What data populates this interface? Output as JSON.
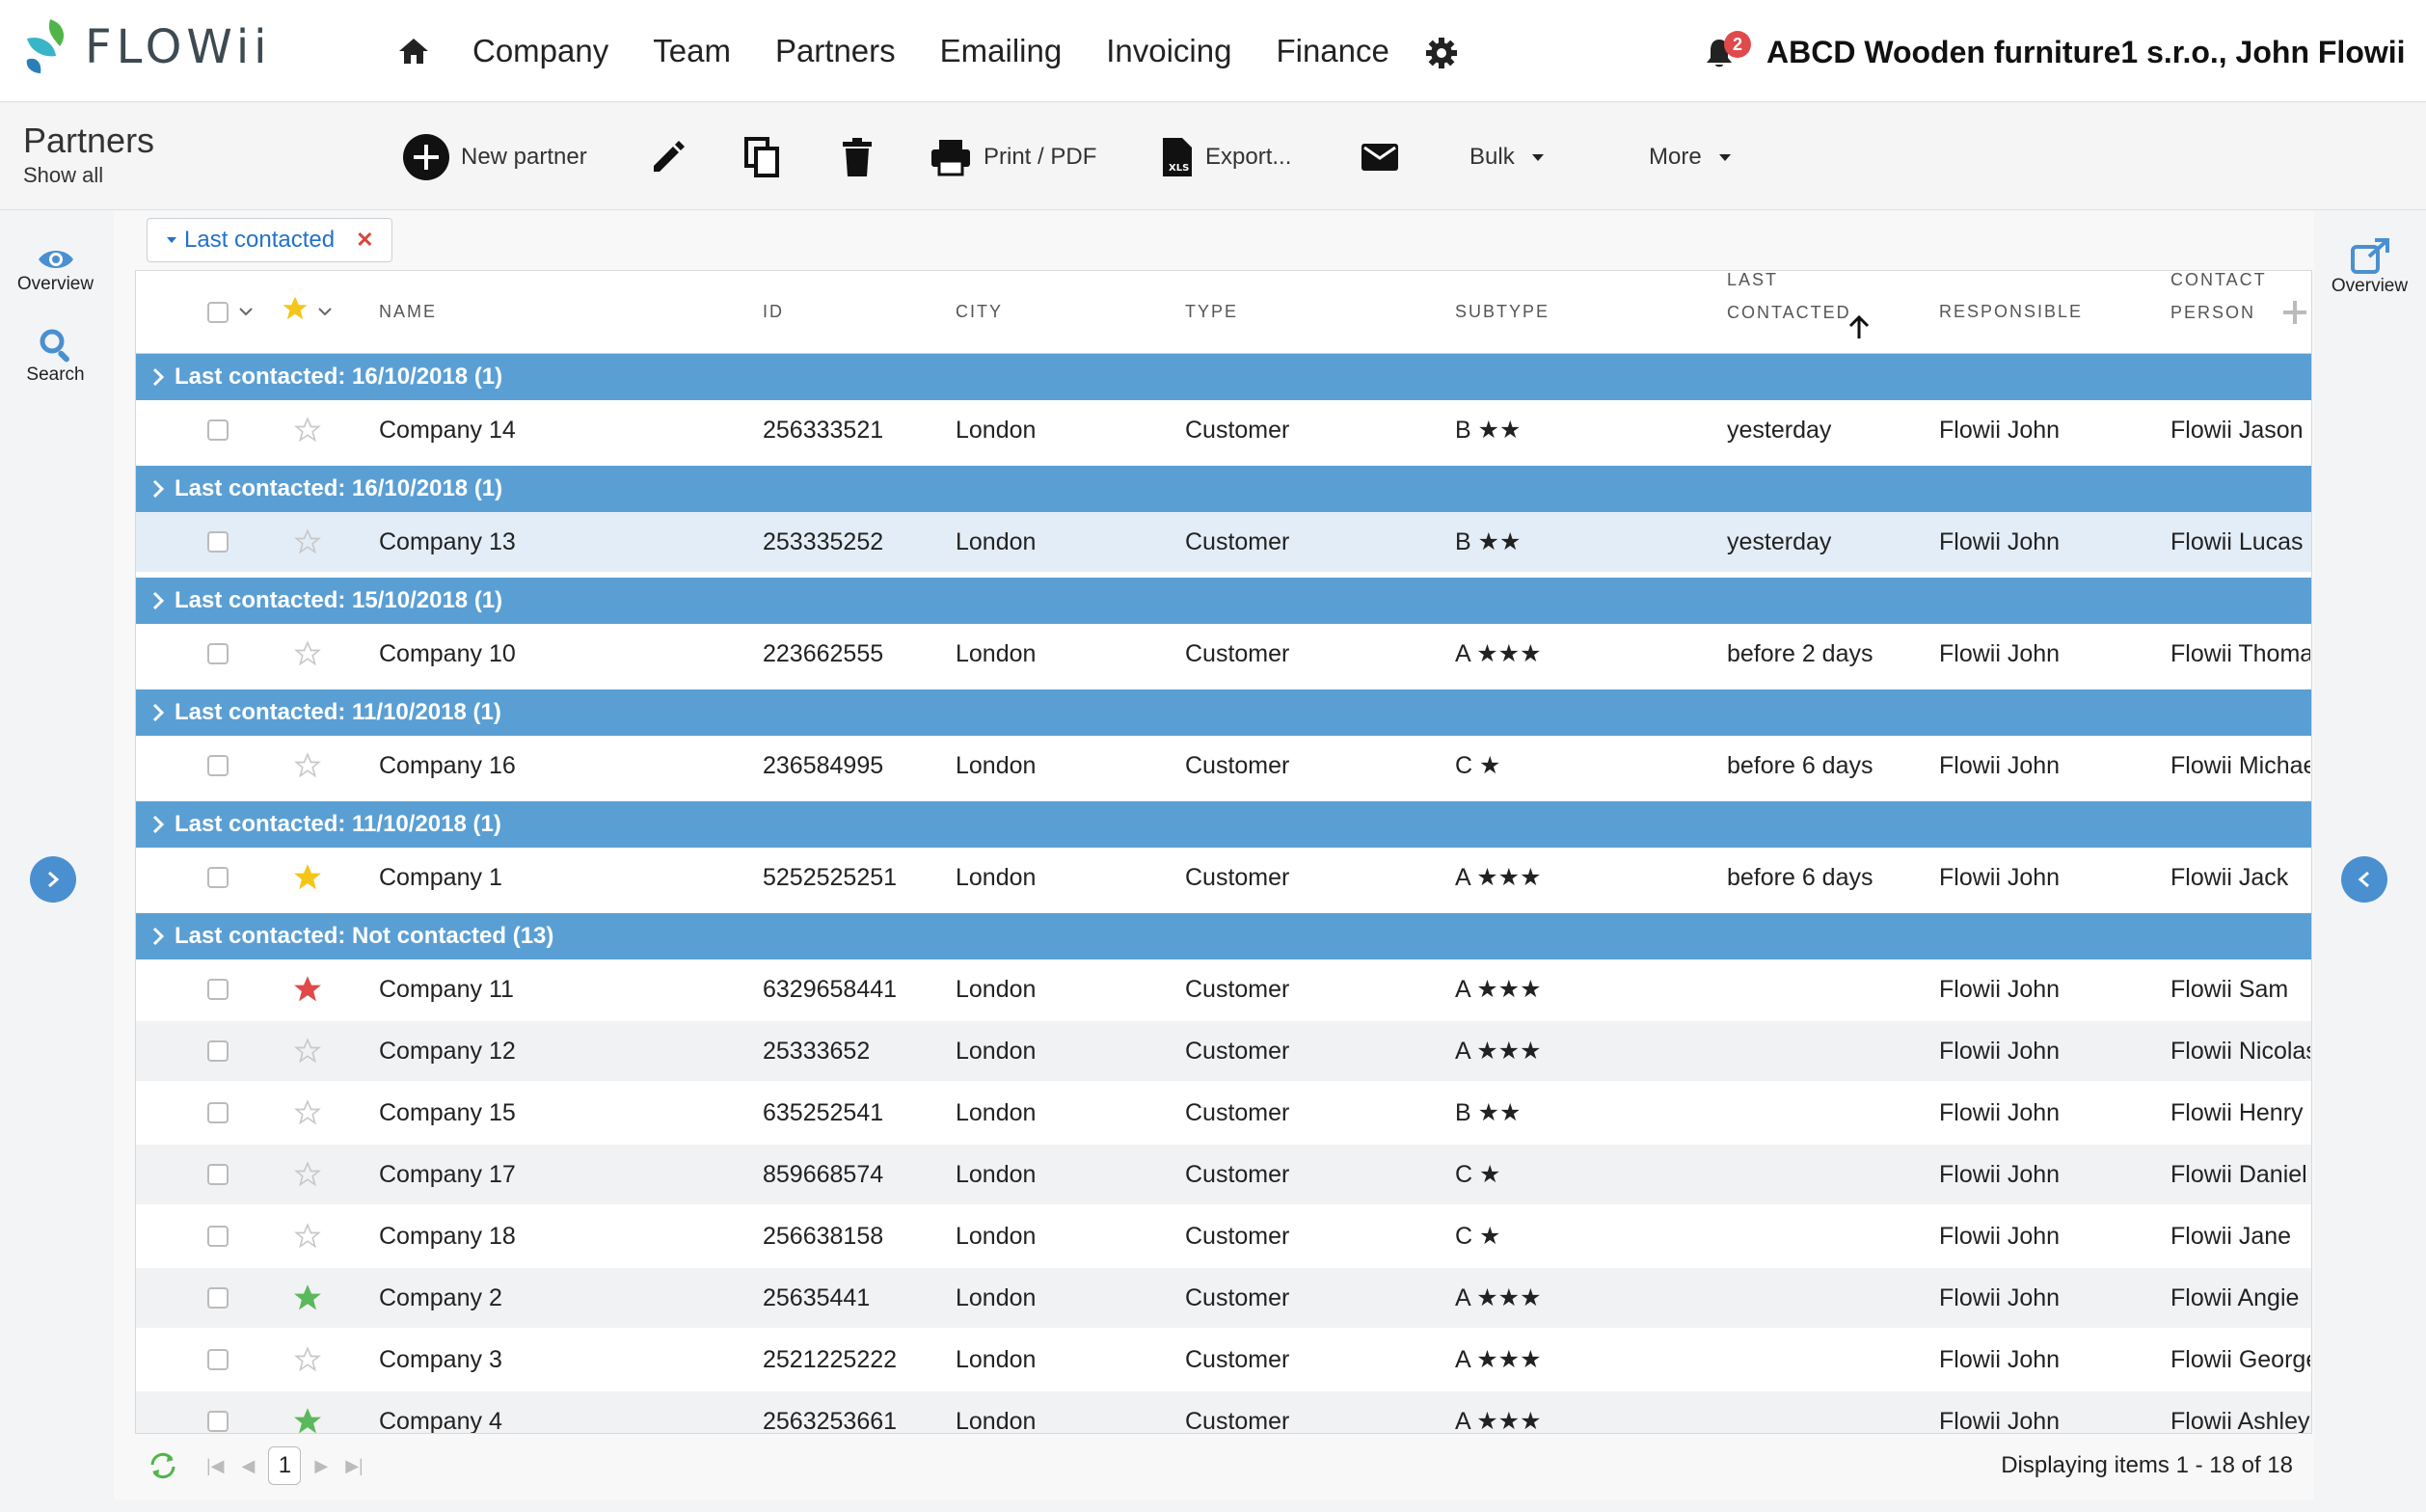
{
  "app": {
    "logo_text": "FLOWii",
    "company_user": "ABCD Wooden furniture1 s.r.o., John Flowii",
    "notification_count": "2"
  },
  "nav": [
    "Company",
    "Team",
    "Partners",
    "Emailing",
    "Invoicing",
    "Finance"
  ],
  "page": {
    "title": "Partners",
    "subtitle": "Show all"
  },
  "toolbar": {
    "new_partner": "New partner",
    "print": "Print / PDF",
    "export": "Export...",
    "bulk": "Bulk",
    "more": "More"
  },
  "side": {
    "overview": "Overview",
    "search": "Search",
    "right_overview": "Overview"
  },
  "filter": {
    "label": "Last contacted"
  },
  "columns": {
    "name": "NAME",
    "id": "ID",
    "city": "CITY",
    "type": "TYPE",
    "subtype": "SUBTYPE",
    "last1": "LAST",
    "last2": "CONTACTED",
    "responsible": "RESPONSIBLE",
    "contact1": "CONTACT",
    "contact2": "PERSON"
  },
  "colors": {
    "group": "#5a9fd4",
    "accent": "#4a90d0",
    "star_yellow": "#f5c518",
    "star_red": "#e04a4a",
    "star_green": "#5cb85c"
  },
  "groups": [
    {
      "label": "Last contacted: 16/10/2018 (1)"
    },
    {
      "label": "Last contacted: 16/10/2018 (1)"
    },
    {
      "label": "Last contacted: 15/10/2018 (1)"
    },
    {
      "label": "Last contacted: 11/10/2018 (1)"
    },
    {
      "label": "Last contacted: 11/10/2018 (1)"
    },
    {
      "label": "Last contacted: Not contacted (13)"
    }
  ],
  "rows": [
    {
      "name": "Company 14",
      "id": "256333521",
      "city": "London",
      "type": "Customer",
      "subtype": "B ★★",
      "last": "yesterday",
      "responsible": "Flowii John",
      "contact": "Flowii Jason",
      "star": "empty"
    },
    {
      "name": "Company 13",
      "id": "253335252",
      "city": "London",
      "type": "Customer",
      "subtype": "B ★★",
      "last": "yesterday",
      "responsible": "Flowii John",
      "contact": "Flowii Lucas",
      "star": "empty"
    },
    {
      "name": "Company 10",
      "id": "223662555",
      "city": "London",
      "type": "Customer",
      "subtype": "A ★★★",
      "last": "before 2 days",
      "responsible": "Flowii John",
      "contact": "Flowii Thomas",
      "star": "empty"
    },
    {
      "name": "Company 16",
      "id": "236584995",
      "city": "London",
      "type": "Customer",
      "subtype": "C ★",
      "last": "before 6 days",
      "responsible": "Flowii John",
      "contact": "Flowii Michael",
      "star": "empty"
    },
    {
      "name": "Company 1",
      "id": "5252525251",
      "city": "London",
      "type": "Customer",
      "subtype": "A ★★★",
      "last": "before 6 days",
      "responsible": "Flowii John",
      "contact": "Flowii Jack",
      "star": "yellow"
    },
    {
      "name": "Company 11",
      "id": "6329658441",
      "city": "London",
      "type": "Customer",
      "subtype": "A ★★★",
      "last": "",
      "responsible": "Flowii John",
      "contact": "Flowii Sam",
      "star": "red"
    },
    {
      "name": "Company 12",
      "id": "25333652",
      "city": "London",
      "type": "Customer",
      "subtype": "A ★★★",
      "last": "",
      "responsible": "Flowii John",
      "contact": "Flowii Nicolas",
      "star": "empty"
    },
    {
      "name": "Company 15",
      "id": "635252541",
      "city": "London",
      "type": "Customer",
      "subtype": "B ★★",
      "last": "",
      "responsible": "Flowii John",
      "contact": "Flowii Henry",
      "star": "empty"
    },
    {
      "name": "Company 17",
      "id": "859668574",
      "city": "London",
      "type": "Customer",
      "subtype": "C ★",
      "last": "",
      "responsible": "Flowii John",
      "contact": "Flowii Daniel",
      "star": "empty"
    },
    {
      "name": "Company 18",
      "id": "256638158",
      "city": "London",
      "type": "Customer",
      "subtype": "C ★",
      "last": "",
      "responsible": "Flowii John",
      "contact": "Flowii Jane",
      "star": "empty"
    },
    {
      "name": "Company 2",
      "id": "25635441",
      "city": "London",
      "type": "Customer",
      "subtype": "A ★★★",
      "last": "",
      "responsible": "Flowii John",
      "contact": "Flowii Angie",
      "star": "green"
    },
    {
      "name": "Company 3",
      "id": "2521225222",
      "city": "London",
      "type": "Customer",
      "subtype": "A ★★★",
      "last": "",
      "responsible": "Flowii John",
      "contact": "Flowii George",
      "star": "empty"
    },
    {
      "name": "Company 4",
      "id": "2563253661",
      "city": "London",
      "type": "Customer",
      "subtype": "A ★★★",
      "last": "",
      "responsible": "Flowii John",
      "contact": "Flowii Ashley",
      "star": "green"
    }
  ],
  "footer": {
    "page": "1",
    "display": "Displaying items 1 - 18 of 18"
  }
}
